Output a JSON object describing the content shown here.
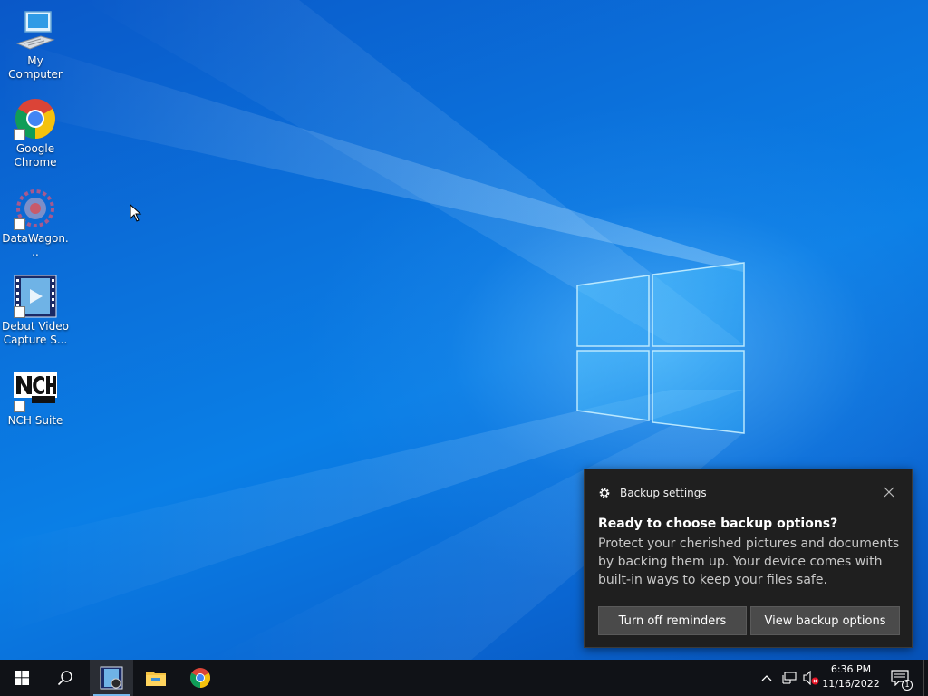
{
  "desktop": {
    "icons": [
      {
        "label": "My Computer",
        "icon": "computer-icon"
      },
      {
        "label": "Google Chrome",
        "icon": "chrome-icon"
      },
      {
        "label": "DataWagon...",
        "icon": "datawagon-icon"
      },
      {
        "label": "Debut Video Capture S...",
        "icon": "debut-video-icon"
      },
      {
        "label": "NCH Suite",
        "icon": "nch-suite-icon"
      }
    ]
  },
  "toast": {
    "app_name": "Backup settings",
    "title": "Ready to choose backup options?",
    "body": "Protect your cherished pictures and documents by backing them up. Your device comes with built-in ways to keep your files safe.",
    "button_reminders": "Turn off reminders",
    "button_view": "View backup options"
  },
  "taskbar": {
    "apps": [
      "start-icon",
      "search-icon",
      "debut-video-icon",
      "file-explorer-icon",
      "chrome-icon"
    ],
    "tray": [
      "chevron-up-icon",
      "network-icon",
      "volume-muted-icon"
    ],
    "time": "6:36 PM",
    "date": "11/16/2022",
    "notification_count": "1"
  },
  "colors": {
    "taskbar": "#101217",
    "toast_bg": "#1f1f1f",
    "toast_button": "#4a4a4a",
    "desktop_blue": "#0a72dc"
  }
}
